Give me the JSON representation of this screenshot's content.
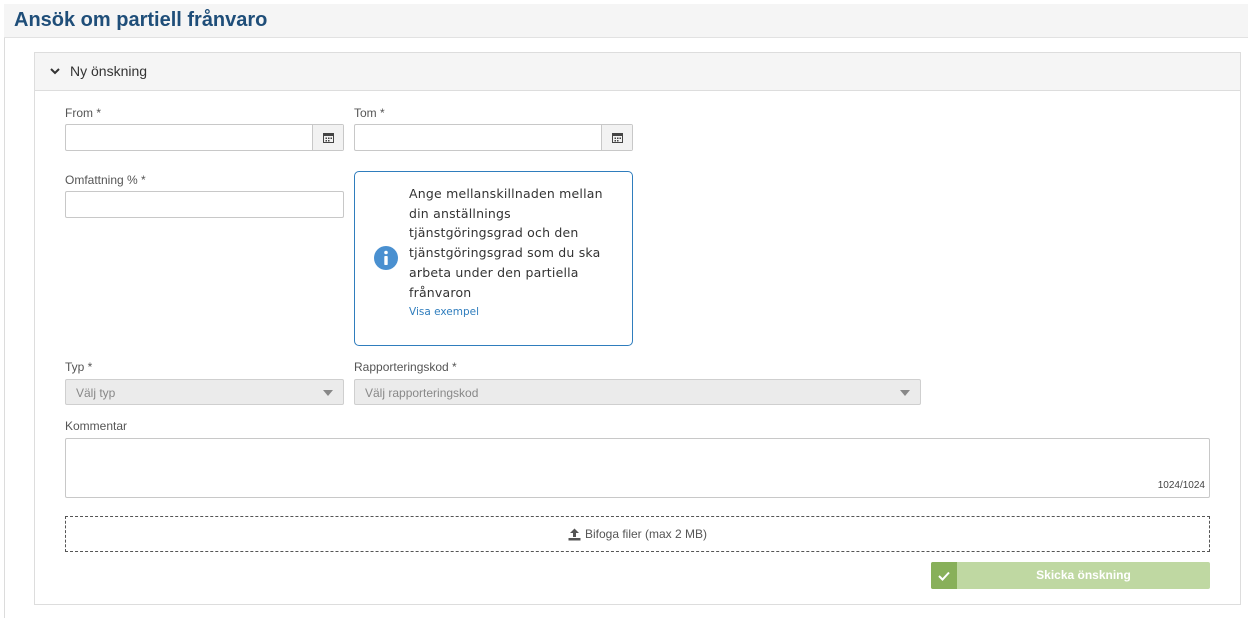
{
  "page": {
    "title": "Ansök om partiell frånvaro"
  },
  "panel": {
    "title": "Ny önskning",
    "expanded": true
  },
  "form": {
    "from": {
      "label": "From *",
      "value": ""
    },
    "tom": {
      "label": "Tom *",
      "value": ""
    },
    "omfattning": {
      "label": "Omfattning % *",
      "value": ""
    },
    "info": {
      "text": "Ange mellanskillnaden mellan din anställnings tjänstgöringsgrad och den tjänstgöringsgrad som du ska arbeta under den partiella frånvaron",
      "link": "Visa exempel"
    },
    "typ": {
      "label": "Typ *",
      "placeholder": "Välj typ"
    },
    "rapporteringskod": {
      "label": "Rapporteringskod *",
      "placeholder": "Välj rapporteringskod"
    },
    "kommentar": {
      "label": "Kommentar",
      "value": "",
      "counter": "1024/1024"
    },
    "upload": {
      "label": "Bifoga filer (max 2 MB)"
    },
    "submit": {
      "label": "Skicka önskning"
    }
  },
  "colors": {
    "title": "#1f4e79",
    "info_border": "#2f7dbd",
    "submit_bg": "#bfd8a2",
    "submit_check_bg": "#88b05a"
  }
}
